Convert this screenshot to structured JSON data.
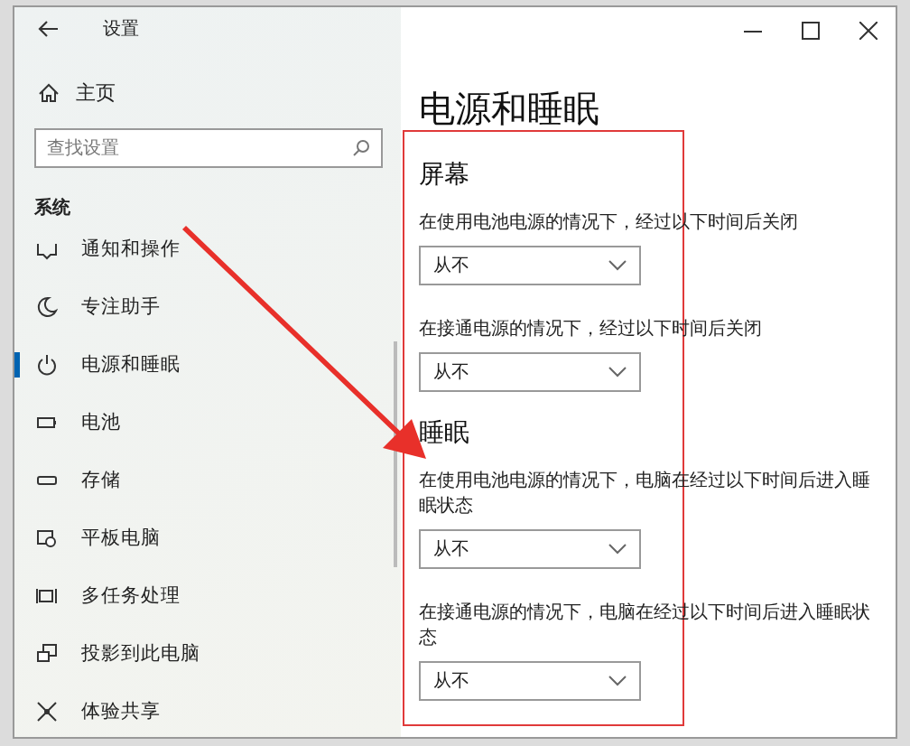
{
  "window": {
    "title": "设置"
  },
  "sidebar": {
    "home": "主页",
    "search": {
      "placeholder": "查找设置"
    },
    "section": "系统",
    "items": [
      {
        "label": "通知和操作",
        "selected": false
      },
      {
        "label": "专注助手",
        "selected": false
      },
      {
        "label": "电源和睡眠",
        "selected": true
      },
      {
        "label": "电池",
        "selected": false
      },
      {
        "label": "存储",
        "selected": false
      },
      {
        "label": "平板电脑",
        "selected": false
      },
      {
        "label": "多任务处理",
        "selected": false
      },
      {
        "label": "投影到此电脑",
        "selected": false
      },
      {
        "label": "体验共享",
        "selected": false
      }
    ]
  },
  "content": {
    "title": "电源和睡眠",
    "sections": [
      {
        "heading": "屏幕",
        "settings": [
          {
            "label": "在使用电池电源的情况下，经过以下时间后关闭",
            "value": "从不"
          },
          {
            "label": "在接通电源的情况下，经过以下时间后关闭",
            "value": "从不"
          }
        ]
      },
      {
        "heading": "睡眠",
        "settings": [
          {
            "label": "在使用电池电源的情况下，电脑在经过以下时间后进入睡眠状态",
            "value": "从不"
          },
          {
            "label": "在接通电源的情况下，电脑在经过以下时间后进入睡眠状态",
            "value": "从不"
          }
        ]
      }
    ]
  }
}
